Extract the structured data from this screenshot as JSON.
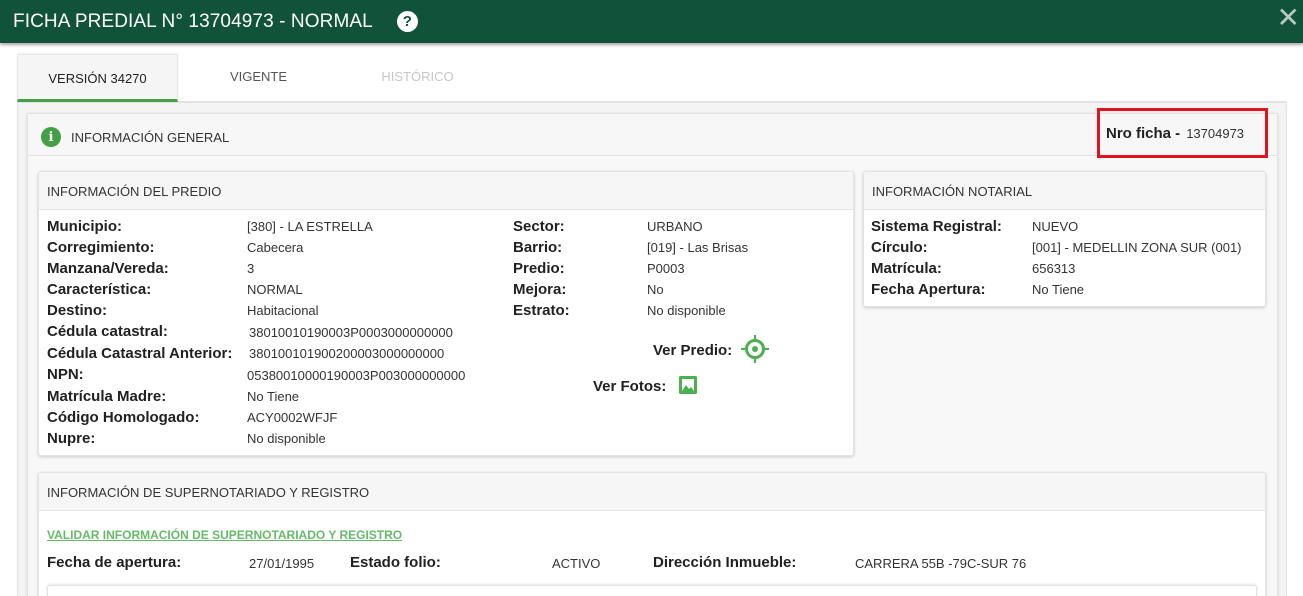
{
  "header": {
    "title": "FICHA PREDIAL N° 13704973 - NORMAL",
    "help_icon": "?",
    "close_icon": "✕"
  },
  "tabs": [
    {
      "label": "VERSIÓN 34270",
      "state": "active"
    },
    {
      "label": "VIGENTE",
      "state": "enabled"
    },
    {
      "label": "HISTÓRICO",
      "state": "disabled"
    }
  ],
  "general": {
    "title": "INFORMACIÓN GENERAL",
    "info_icon": "i",
    "nro_ficha_label": "Nro ficha -",
    "nro_ficha_value": "13704973"
  },
  "predio": {
    "title": "INFORMACIÓN DEL PREDIO",
    "left": [
      {
        "label": "Municipio:",
        "value": "[380] - LA ESTRELLA"
      },
      {
        "label": "Corregimiento:",
        "value": "Cabecera"
      },
      {
        "label": "Manzana/Vereda:",
        "value": "3"
      },
      {
        "label": "Característica:",
        "value": "NORMAL"
      },
      {
        "label": "Destino:",
        "value": "Habitacional"
      },
      {
        "label": "Cédula catastral:",
        "value": "38010010190003P0003000000000"
      },
      {
        "label": "Cédula Catastral Anterior:",
        "value": "380100101900200003000000000"
      },
      {
        "label": "NPN:",
        "value": "05380010000190003P003000000000"
      },
      {
        "label": "Matrícula Madre:",
        "value": "No Tiene"
      },
      {
        "label": "Código Homologado:",
        "value": "ACY0002WFJF"
      },
      {
        "label": "Nupre:",
        "value": "No disponible"
      }
    ],
    "right": [
      {
        "label": "Sector:",
        "value": "URBANO"
      },
      {
        "label": "Barrio:",
        "value": "[019] - Las Brisas"
      },
      {
        "label": "Predio:",
        "value": "P0003"
      },
      {
        "label": "Mejora:",
        "value": "No"
      },
      {
        "label": "Estrato:",
        "value": "No disponible"
      }
    ],
    "ver_predio": "Ver Predio:",
    "ver_fotos": "Ver Fotos:",
    "accent": "#4caf50"
  },
  "notarial": {
    "title": "INFORMACIÓN NOTARIAL",
    "rows": [
      {
        "label": "Sistema Registral:",
        "value": "NUEVO"
      },
      {
        "label": "Círculo:",
        "value": "[001] - MEDELLIN ZONA SUR (001)"
      },
      {
        "label": "Matrícula:",
        "value": "656313"
      },
      {
        "label": "Fecha Apertura:",
        "value": "No Tiene"
      }
    ]
  },
  "supernotariado": {
    "title": "INFORMACIÓN DE SUPERNOTARIADO Y REGISTRO",
    "link": "VALIDAR INFORMACIÓN DE SUPERNOTARIADO Y REGISTRO",
    "fields": [
      {
        "label": "Fecha de apertura:",
        "value": "27/01/1995"
      },
      {
        "label": "Estado folio:",
        "value": "ACTIVO"
      },
      {
        "label": "Dirección Inmueble:",
        "value": "CARRERA 55B -79C-SUR 76"
      }
    ]
  },
  "colors": {
    "header": "#11533a",
    "accent_green": "#43a047",
    "highlight_red": "#e0141e"
  }
}
